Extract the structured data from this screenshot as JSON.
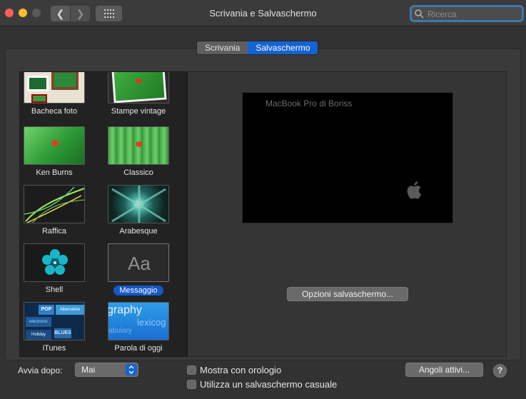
{
  "window": {
    "title": "Scrivania e Salvaschermo",
    "search_placeholder": "Ricerca"
  },
  "tabs": [
    {
      "label": "Scrivania",
      "selected": false
    },
    {
      "label": "Salvaschermo",
      "selected": true
    }
  ],
  "screensavers": [
    {
      "label": "Bacheca foto",
      "selected": false
    },
    {
      "label": "Stampe vintage",
      "selected": false
    },
    {
      "label": "Ken Burns",
      "selected": false
    },
    {
      "label": "Classico",
      "selected": false
    },
    {
      "label": "Raffica",
      "selected": false
    },
    {
      "label": "Arabesque",
      "selected": false
    },
    {
      "label": "Shell",
      "selected": false
    },
    {
      "label": "Messaggio",
      "selected": true
    },
    {
      "label": "iTunes",
      "selected": false
    },
    {
      "label": "Parola di oggi",
      "selected": false
    }
  ],
  "thumb_text": {
    "messaggio": "Aa",
    "itunes": [
      "POP",
      "Alternative",
      "electronic",
      "BLUES",
      "Holiday"
    ],
    "parola": [
      "graphy",
      "lexicog",
      "abulary"
    ]
  },
  "preview": {
    "message": "MacBook Pro di Boriss"
  },
  "options_button": "Opzioni salvaschermo...",
  "start_after": {
    "label": "Avvia dopo:",
    "value": "Mai"
  },
  "show_clock": {
    "label": "Mostra con orologio",
    "checked": false
  },
  "random_saver": {
    "label": "Utilizza un salvaschermo casuale",
    "checked": false
  },
  "hot_corners_button": "Angoli attivi...",
  "help_button": "?",
  "colors": {
    "accent": "#1464d2",
    "window_bg": "#323232"
  }
}
